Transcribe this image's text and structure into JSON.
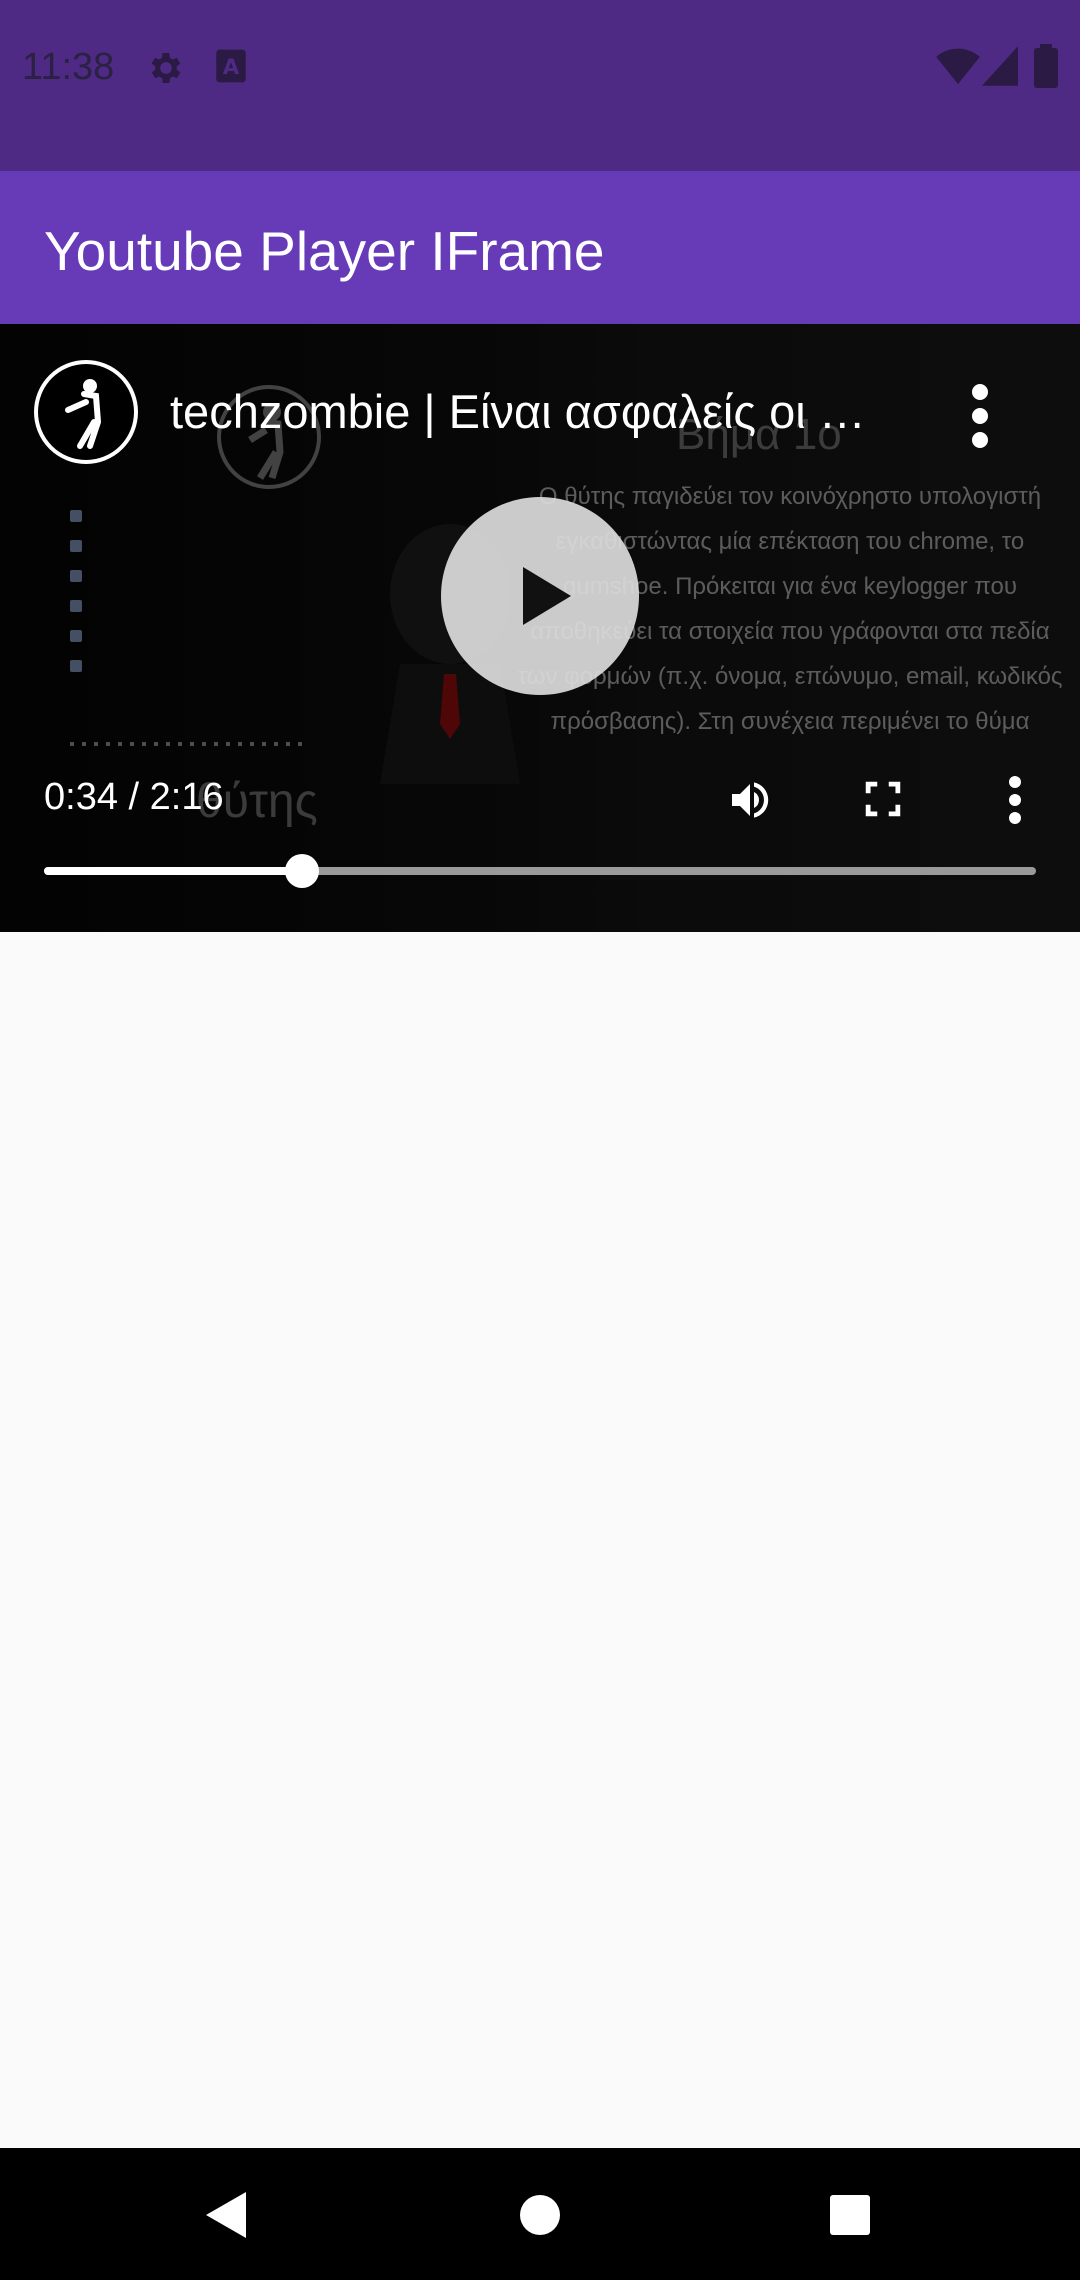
{
  "status_bar": {
    "time": "11:38",
    "left_icons": [
      "gear-icon",
      "keyboard-a-icon"
    ],
    "right_icons": [
      "wifi-icon",
      "cell-signal-icon",
      "battery-icon"
    ],
    "color": "#4e2a84"
  },
  "app_bar": {
    "title": "Youtube Player IFrame",
    "color": "#673ab7"
  },
  "player": {
    "video_title": "techzombie | Είναι ασφαλείς οι …",
    "frame_heading": "Βήμα 1ο",
    "frame_body": "Ο θύτης παγιδεύει τον κοινόχρηστο υπολογιστή εγκαθιστώντας μία επέκταση του chrome, το gumshoe. Πρόκειται για ένα keylogger που αποθηκεύει τα στοιχεία που γράφονται στα πεδία των φορμών (π.χ. όνομα, επώνυμο, email, κωδικός πρόσβασης). Στη συνέχεια περιμένει το θύμα",
    "frame_caption": "θύτης",
    "current_time": "0:34",
    "separator": " / ",
    "duration": "2:16",
    "progress_fraction": 0.26,
    "icons": [
      "play-icon",
      "volume-icon",
      "fullscreen-icon",
      "more-vert-icon"
    ]
  },
  "nav_bar": {
    "icons": [
      "back-icon",
      "home-icon",
      "recents-icon"
    ]
  }
}
